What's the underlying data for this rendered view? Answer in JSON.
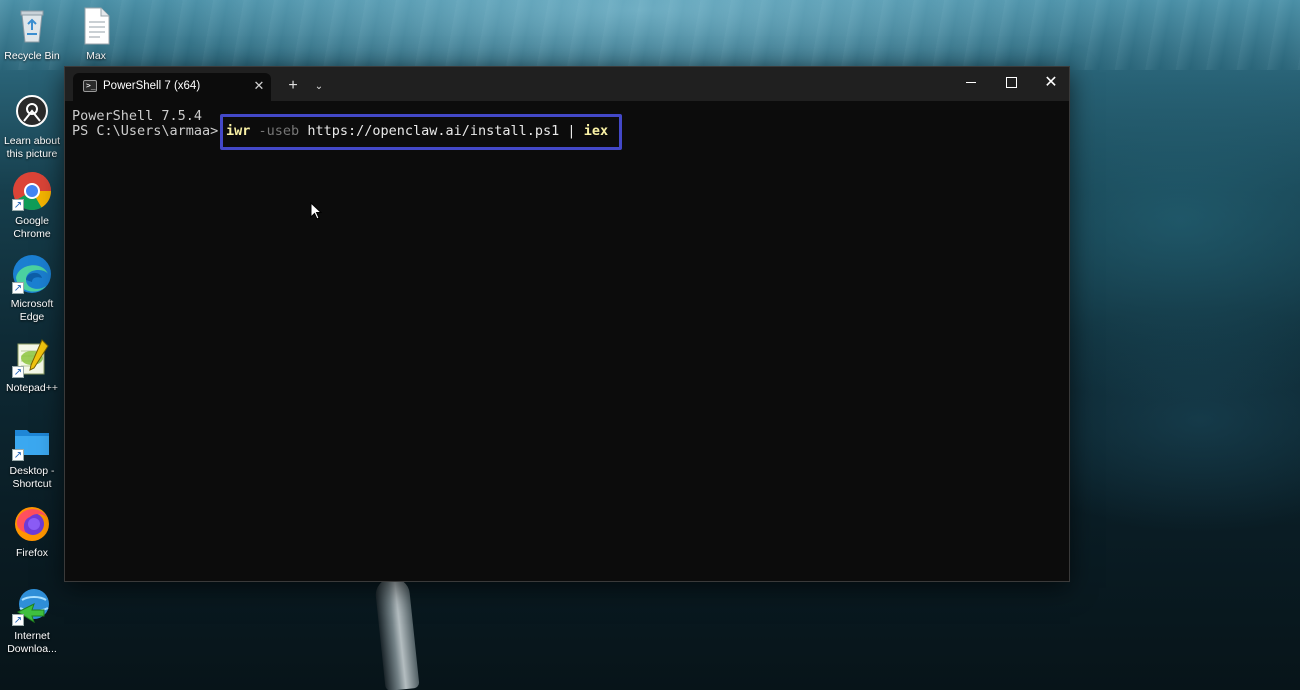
{
  "desktop": {
    "icons": [
      {
        "label": "Recycle Bin",
        "icon": "recycle-bin-icon"
      },
      {
        "label": "Max",
        "icon": "document-icon"
      },
      {
        "label": "Learn about this picture",
        "icon": "camera-icon"
      },
      {
        "label": "Google Chrome",
        "icon": "chrome-icon"
      },
      {
        "label": "Microsoft Edge",
        "icon": "edge-icon"
      },
      {
        "label": "Notepad++",
        "icon": "notepad-plus-plus-icon"
      },
      {
        "label": "Desktop - Shortcut",
        "icon": "folder-icon"
      },
      {
        "label": "Firefox",
        "icon": "firefox-icon"
      },
      {
        "label": "Internet Downloa...",
        "icon": "internet-download-manager-icon"
      }
    ],
    "shortcut_glyph": "↗"
  },
  "window": {
    "tab": {
      "title": "PowerShell 7 (x64)",
      "icon_glyph": ">_",
      "close_glyph": "✕"
    },
    "new_tab_glyph": "+",
    "dropdown_glyph": "⌄",
    "close_glyph": "✕"
  },
  "terminal": {
    "version_line": "PowerShell 7.5.4",
    "prompt": "PS C:\\Users\\armaa>",
    "command": {
      "keyword": "iwr",
      "param": "-useb",
      "url": "https://openclaw.ai/install.ps1",
      "pipe": "|",
      "pipe_target": "iex"
    }
  },
  "colors": {
    "highlight_border": "#4348c8",
    "command_keyword": "#f9f1a5",
    "command_param": "#767676",
    "terminal_bg": "#0c0c0c",
    "titlebar_bg": "#202020"
  }
}
